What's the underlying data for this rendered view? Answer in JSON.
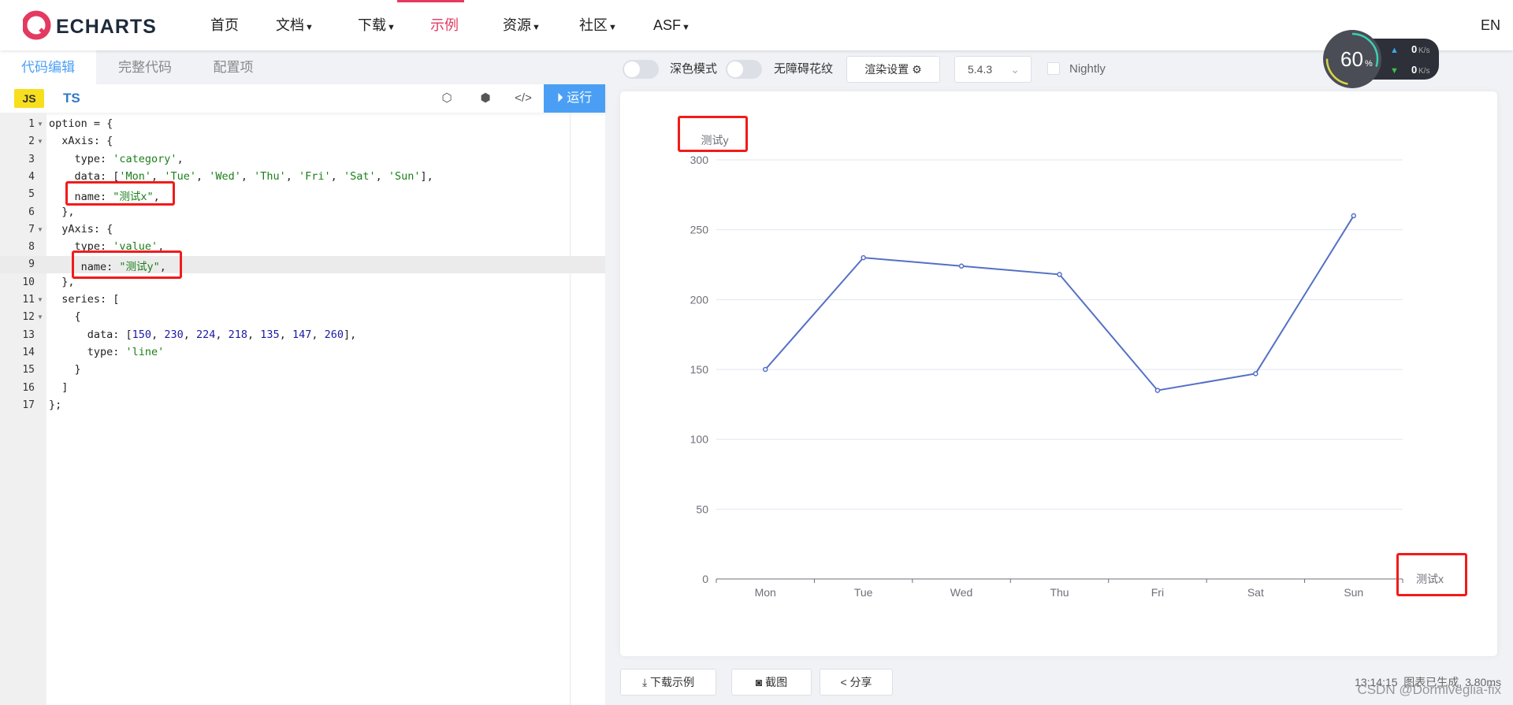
{
  "nav": {
    "logo": "ECHARTS",
    "items": [
      {
        "label": "首页"
      },
      {
        "label": "文档",
        "caret": true
      },
      {
        "label": "下载",
        "caret": true
      },
      {
        "label": "示例",
        "active": true
      },
      {
        "label": "资源",
        "caret": true
      },
      {
        "label": "社区",
        "caret": true
      },
      {
        "label": "ASF",
        "caret": true
      }
    ],
    "lang": "EN",
    "accent": "#e43961"
  },
  "editor": {
    "tabs": [
      "代码编辑",
      "完整代码",
      "配置项"
    ],
    "js": "JS",
    "ts": "TS",
    "run": "运行",
    "icons": [
      "codepen-icon",
      "codesandbox-icon",
      "embed-code-icon"
    ],
    "lines": [
      [
        [
          "option = {",
          ""
        ]
      ],
      [
        [
          "  xAxis: {",
          ""
        ]
      ],
      [
        [
          "    type: ",
          ""
        ],
        [
          "'category'",
          "s"
        ],
        [
          ",",
          ""
        ]
      ],
      [
        [
          "    data: [",
          ""
        ],
        [
          "'Mon'",
          "s"
        ],
        [
          ", ",
          ""
        ],
        [
          "'Tue'",
          "s"
        ],
        [
          ", ",
          ""
        ],
        [
          "'Wed'",
          "s"
        ],
        [
          ", ",
          ""
        ],
        [
          "'Thu'",
          "s"
        ],
        [
          ", ",
          ""
        ],
        [
          "'Fri'",
          "s"
        ],
        [
          ", ",
          ""
        ],
        [
          "'Sat'",
          "s"
        ],
        [
          ", ",
          ""
        ],
        [
          "'Sun'",
          "s"
        ],
        [
          "],",
          ""
        ]
      ],
      [
        [
          "    name: ",
          ""
        ],
        [
          "\"测试x\"",
          "s"
        ],
        [
          ",",
          ""
        ]
      ],
      [
        [
          "  },",
          ""
        ]
      ],
      [
        [
          "  yAxis: {",
          ""
        ]
      ],
      [
        [
          "    type: ",
          ""
        ],
        [
          "'value'",
          "s"
        ],
        [
          ",",
          ""
        ]
      ],
      [
        [
          "     name: ",
          ""
        ],
        [
          "\"测试y\"",
          "s"
        ],
        [
          ",",
          ""
        ]
      ],
      [
        [
          "  },",
          ""
        ]
      ],
      [
        [
          "  series: [",
          ""
        ]
      ],
      [
        [
          "    {",
          ""
        ]
      ],
      [
        [
          "      data: [",
          ""
        ],
        [
          "150",
          "n"
        ],
        [
          ", ",
          ""
        ],
        [
          "230",
          "n"
        ],
        [
          ", ",
          ""
        ],
        [
          "224",
          "n"
        ],
        [
          ", ",
          ""
        ],
        [
          "218",
          "n"
        ],
        [
          ", ",
          ""
        ],
        [
          "135",
          "n"
        ],
        [
          ", ",
          ""
        ],
        [
          "147",
          "n"
        ],
        [
          ", ",
          ""
        ],
        [
          "260",
          "n"
        ],
        [
          "],",
          ""
        ]
      ],
      [
        [
          "      type: ",
          ""
        ],
        [
          "'line'",
          "s"
        ]
      ],
      [
        [
          "    }",
          ""
        ]
      ],
      [
        [
          "  ]",
          ""
        ]
      ],
      [
        [
          "};",
          ""
        ]
      ]
    ],
    "folds": [
      1,
      2,
      7,
      11,
      12
    ],
    "highlight_line": 9
  },
  "toolbar": {
    "dark_mode": "深色模式",
    "decal": "无障碍花纹",
    "render_settings": "渲染设置",
    "version": "5.4.3",
    "nightly": "Nightly"
  },
  "fps": {
    "value": "60",
    "unit": "%",
    "up": "0",
    "down": "0",
    "rate_unit": "K/s"
  },
  "chart_data": {
    "type": "line",
    "categories": [
      "Mon",
      "Tue",
      "Wed",
      "Thu",
      "Fri",
      "Sat",
      "Sun"
    ],
    "values": [
      150,
      230,
      224,
      218,
      135,
      147,
      260
    ],
    "xlabel": "测试x",
    "ylabel": "测试y",
    "ylim": [
      0,
      300
    ],
    "yticks": [
      0,
      50,
      100,
      150,
      200,
      250,
      300
    ],
    "color": "#5470c6",
    "grid": true
  },
  "footer": {
    "download": "下载示例",
    "screenshot": "截图",
    "share": "分享",
    "status": "13:14:15  图表已生成, 3.80ms",
    "watermark": "CSDN @Dormiveglia-fix"
  }
}
